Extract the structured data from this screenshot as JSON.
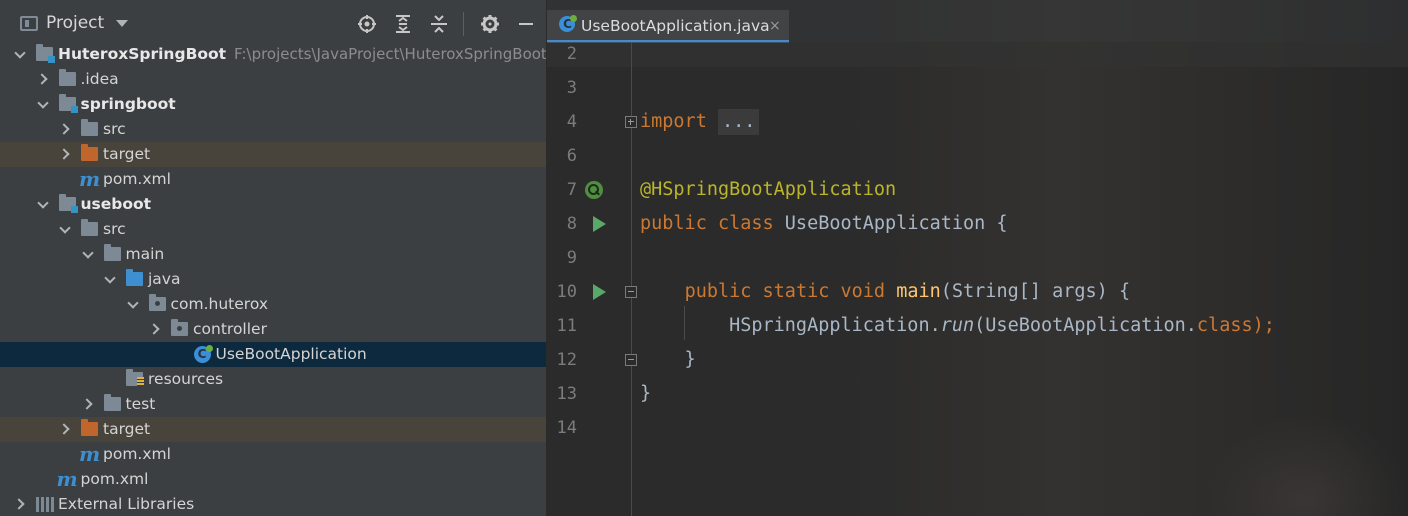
{
  "project_panel": {
    "title": "Project",
    "tools": [
      "locate-icon",
      "expand-all-icon",
      "collapse-all-icon",
      "gear-icon",
      "minimize-icon"
    ],
    "tree": [
      {
        "label": "HuteroxSpringBoot",
        "path": "F:\\projects\\JavaProject\\HuteroxSpringBoot",
        "depth": 0,
        "arrow": "down",
        "icon": "module-folder-icon",
        "bold": true
      },
      {
        "label": ".idea",
        "depth": 1,
        "arrow": "right",
        "icon": "folder-icon"
      },
      {
        "label": "springboot",
        "depth": 1,
        "arrow": "down",
        "icon": "module-folder-icon",
        "bold": true
      },
      {
        "label": "src",
        "depth": 2,
        "arrow": "right",
        "icon": "folder-icon"
      },
      {
        "label": "target",
        "depth": 2,
        "arrow": "right",
        "icon": "excluded-folder-icon",
        "highlight": "target"
      },
      {
        "label": "pom.xml",
        "depth": 2,
        "arrow": "none",
        "icon": "maven-icon"
      },
      {
        "label": "useboot",
        "depth": 1,
        "arrow": "down",
        "icon": "module-folder-icon",
        "bold": true
      },
      {
        "label": "src",
        "depth": 2,
        "arrow": "down",
        "icon": "folder-icon"
      },
      {
        "label": "main",
        "depth": 3,
        "arrow": "down",
        "icon": "folder-icon"
      },
      {
        "label": "java",
        "depth": 4,
        "arrow": "down",
        "icon": "source-folder-icon"
      },
      {
        "label": "com.huterox",
        "depth": 5,
        "arrow": "down",
        "icon": "package-icon"
      },
      {
        "label": "controller",
        "depth": 6,
        "arrow": "right",
        "icon": "package-icon"
      },
      {
        "label": "UseBootApplication",
        "depth": 7,
        "arrow": "none",
        "icon": "spring-boot-class-icon",
        "selected": true
      },
      {
        "label": "resources",
        "depth": 4,
        "arrow": "none",
        "icon": "resources-folder-icon"
      },
      {
        "label": "test",
        "depth": 3,
        "arrow": "right",
        "icon": "folder-icon"
      },
      {
        "label": "target",
        "depth": 2,
        "arrow": "right",
        "icon": "excluded-folder-icon",
        "highlight": "target"
      },
      {
        "label": "pom.xml",
        "depth": 2,
        "arrow": "none",
        "icon": "maven-icon"
      },
      {
        "label": "pom.xml",
        "depth": 1,
        "arrow": "none",
        "icon": "maven-icon"
      },
      {
        "label": "External Libraries",
        "depth": 0,
        "arrow": "right",
        "icon": "libraries-icon"
      }
    ]
  },
  "editor": {
    "tab": {
      "label": "UseBootApplication.java",
      "close": "×",
      "icon": "spring-boot-class-icon"
    },
    "lines": [
      {
        "n": "2",
        "tokens": []
      },
      {
        "n": "3",
        "tokens": []
      },
      {
        "n": "4",
        "fold": "plus",
        "tokens": [
          {
            "t": "import",
            "c": "kw"
          },
          {
            "t": " "
          },
          {
            "t": "...",
            "c": "fold"
          }
        ]
      },
      {
        "n": "6",
        "tokens": []
      },
      {
        "n": "7",
        "gutter": "bean",
        "tokens": [
          {
            "t": "@HSpringBootApplication",
            "c": "ann"
          }
        ]
      },
      {
        "n": "8",
        "gutter": "run",
        "tokens": [
          {
            "t": "public class ",
            "c": "kw"
          },
          {
            "t": "UseBootApplication {"
          }
        ]
      },
      {
        "n": "9",
        "tokens": []
      },
      {
        "n": "10",
        "gutter": "run",
        "fold": "minus",
        "tokens": [
          {
            "t": "    "
          },
          {
            "t": "public static void ",
            "c": "kw"
          },
          {
            "t": "main",
            "c": "fn"
          },
          {
            "t": "(String[] args) {"
          }
        ]
      },
      {
        "n": "11",
        "tokens": [
          {
            "t": "        HSpringApplication."
          },
          {
            "t": "run",
            "c": "it"
          },
          {
            "t": "(UseBootApplication."
          },
          {
            "t": "class",
            "c": "kw"
          },
          {
            "t": ");",
            "c": "kw"
          }
        ]
      },
      {
        "n": "12",
        "fold": "minus",
        "tokens": [
          {
            "t": "    }"
          }
        ]
      },
      {
        "n": "13",
        "tokens": [
          {
            "t": "}"
          }
        ]
      },
      {
        "n": "14",
        "tokens": []
      }
    ]
  },
  "colors": {
    "keyword": "#cc7832",
    "annotation": "#bbb529",
    "method": "#ffc66d",
    "text": "#a9b7c6",
    "selection": "#0d293e",
    "accent": "#4a88c7"
  }
}
